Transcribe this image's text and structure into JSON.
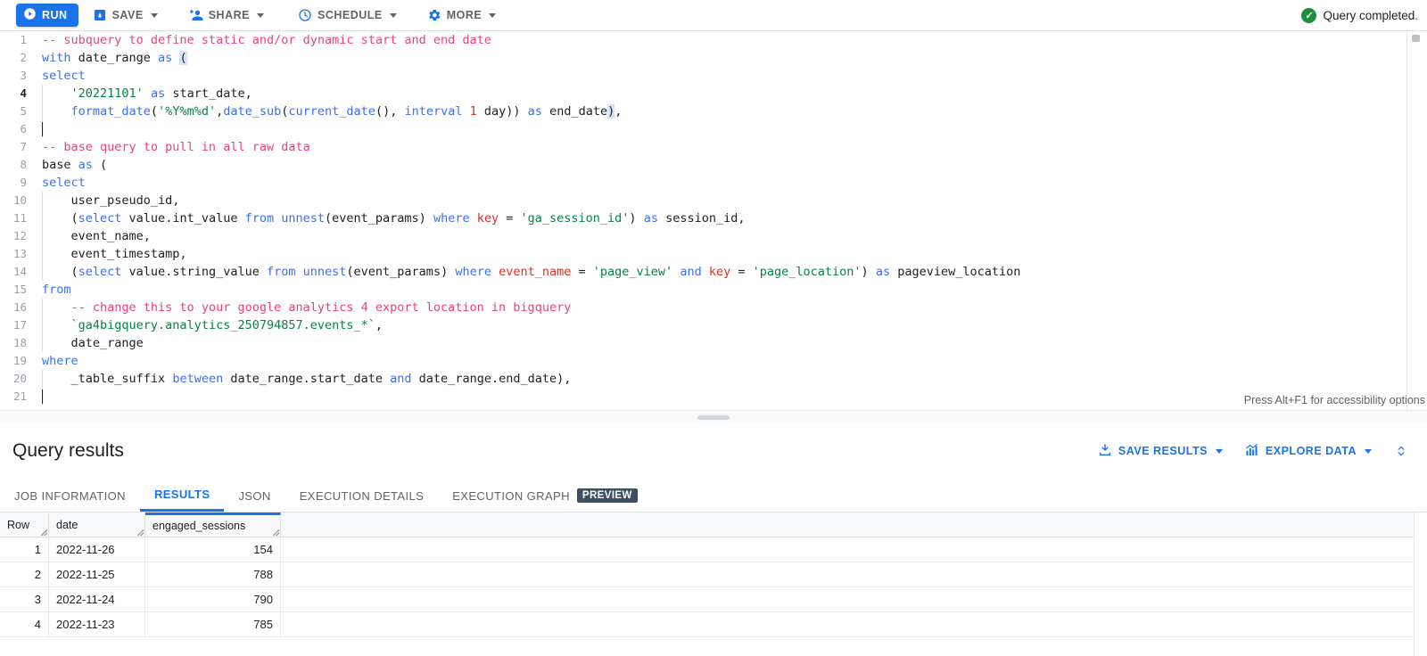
{
  "toolbar": {
    "run_label": "RUN",
    "items": [
      {
        "label": "SAVE",
        "icon": "save-icon"
      },
      {
        "label": "SHARE",
        "icon": "share-person-icon"
      },
      {
        "label": "SCHEDULE",
        "icon": "clock-icon"
      },
      {
        "label": "MORE",
        "icon": "gear-icon"
      }
    ],
    "status_text": "Query completed.",
    "status_color": "#1e8e3e"
  },
  "editor": {
    "accessibility_hint": "Press Alt+F1 for accessibility options",
    "current_line": 4,
    "lines": [
      {
        "n": "1",
        "indent": false,
        "tokens": [
          {
            "t": "-- subquery to define static and/or dynamic start and end date",
            "c": "c"
          }
        ]
      },
      {
        "n": "2",
        "indent": false,
        "tokens": [
          {
            "t": "with ",
            "c": "k"
          },
          {
            "t": "date_range ",
            "c": "p"
          },
          {
            "t": "as ",
            "c": "k"
          },
          {
            "t": "(",
            "c": "p bk"
          }
        ]
      },
      {
        "n": "3",
        "indent": false,
        "tokens": [
          {
            "t": "select",
            "c": "k"
          }
        ]
      },
      {
        "n": "4",
        "indent": true,
        "tokens": [
          {
            "t": "    ",
            "c": "p"
          },
          {
            "t": "'20221101'",
            "c": "s"
          },
          {
            "t": " ",
            "c": "p"
          },
          {
            "t": "as",
            "c": "k"
          },
          {
            "t": " start_date,",
            "c": "p"
          }
        ]
      },
      {
        "n": "5",
        "indent": true,
        "tokens": [
          {
            "t": "    ",
            "c": "p"
          },
          {
            "t": "format_date",
            "c": "k"
          },
          {
            "t": "(",
            "c": "p"
          },
          {
            "t": "'%Y%m%d'",
            "c": "s"
          },
          {
            "t": ",",
            "c": "p"
          },
          {
            "t": "date_sub",
            "c": "k"
          },
          {
            "t": "(",
            "c": "p"
          },
          {
            "t": "current_date",
            "c": "k"
          },
          {
            "t": "(), ",
            "c": "p"
          },
          {
            "t": "interval ",
            "c": "k"
          },
          {
            "t": "1",
            "c": "n"
          },
          {
            "t": " day)) ",
            "c": "p"
          },
          {
            "t": "as",
            "c": "k"
          },
          {
            "t": " end_date",
            "c": "p"
          },
          {
            "t": ")",
            "c": "p bk"
          },
          {
            "t": ",",
            "c": "p"
          }
        ]
      },
      {
        "n": "6",
        "indent": true,
        "tokens": []
      },
      {
        "n": "7",
        "indent": false,
        "tokens": [
          {
            "t": "-- base query to pull in all raw data",
            "c": "c"
          }
        ]
      },
      {
        "n": "8",
        "indent": false,
        "tokens": [
          {
            "t": "base ",
            "c": "p"
          },
          {
            "t": "as",
            "c": "k"
          },
          {
            "t": " (",
            "c": "p"
          }
        ]
      },
      {
        "n": "9",
        "indent": false,
        "tokens": [
          {
            "t": "select",
            "c": "k"
          }
        ]
      },
      {
        "n": "10",
        "indent": true,
        "tokens": [
          {
            "t": "    user_pseudo_id,",
            "c": "p"
          }
        ]
      },
      {
        "n": "11",
        "indent": true,
        "tokens": [
          {
            "t": "    (",
            "c": "p"
          },
          {
            "t": "select",
            "c": "k"
          },
          {
            "t": " value.int_value ",
            "c": "p"
          },
          {
            "t": "from ",
            "c": "k"
          },
          {
            "t": "unnest",
            "c": "k"
          },
          {
            "t": "(event_params) ",
            "c": "p"
          },
          {
            "t": "where ",
            "c": "k"
          },
          {
            "t": "key",
            "c": "n"
          },
          {
            "t": " = ",
            "c": "p"
          },
          {
            "t": "'ga_session_id'",
            "c": "s"
          },
          {
            "t": ") ",
            "c": "p"
          },
          {
            "t": "as",
            "c": "k"
          },
          {
            "t": " session_id,",
            "c": "p"
          }
        ]
      },
      {
        "n": "12",
        "indent": true,
        "tokens": [
          {
            "t": "    event_name,",
            "c": "p"
          }
        ]
      },
      {
        "n": "13",
        "indent": true,
        "tokens": [
          {
            "t": "    event_timestamp,",
            "c": "p"
          }
        ]
      },
      {
        "n": "14",
        "indent": true,
        "tokens": [
          {
            "t": "    (",
            "c": "p"
          },
          {
            "t": "select",
            "c": "k"
          },
          {
            "t": " value.string_value ",
            "c": "p"
          },
          {
            "t": "from ",
            "c": "k"
          },
          {
            "t": "unnest",
            "c": "k"
          },
          {
            "t": "(event_params) ",
            "c": "p"
          },
          {
            "t": "where ",
            "c": "k"
          },
          {
            "t": "event_name",
            "c": "n"
          },
          {
            "t": " = ",
            "c": "p"
          },
          {
            "t": "'page_view'",
            "c": "s"
          },
          {
            "t": " ",
            "c": "p"
          },
          {
            "t": "and ",
            "c": "k"
          },
          {
            "t": "key",
            "c": "n"
          },
          {
            "t": " = ",
            "c": "p"
          },
          {
            "t": "'page_location'",
            "c": "s"
          },
          {
            "t": ") ",
            "c": "p"
          },
          {
            "t": "as",
            "c": "k"
          },
          {
            "t": " pageview_location",
            "c": "p"
          }
        ]
      },
      {
        "n": "15",
        "indent": false,
        "tokens": [
          {
            "t": "from",
            "c": "k"
          }
        ]
      },
      {
        "n": "16",
        "indent": true,
        "tokens": [
          {
            "t": "    ",
            "c": "p"
          },
          {
            "t": "-- change this to your google analytics 4 export location in bigquery",
            "c": "c"
          }
        ]
      },
      {
        "n": "17",
        "indent": true,
        "tokens": [
          {
            "t": "    ",
            "c": "p"
          },
          {
            "t": "`ga4bigquery.analytics_250794857.events_*`",
            "c": "s"
          },
          {
            "t": ",",
            "c": "p"
          }
        ]
      },
      {
        "n": "18",
        "indent": true,
        "tokens": [
          {
            "t": "    date_range",
            "c": "p"
          }
        ]
      },
      {
        "n": "19",
        "indent": false,
        "tokens": [
          {
            "t": "where",
            "c": "k"
          }
        ]
      },
      {
        "n": "20",
        "indent": true,
        "tokens": [
          {
            "t": "    _table_suffix ",
            "c": "p"
          },
          {
            "t": "between",
            "c": "k"
          },
          {
            "t": " date_range.start_date ",
            "c": "p"
          },
          {
            "t": "and",
            "c": "k"
          },
          {
            "t": " date_range.end_date),",
            "c": "p"
          }
        ]
      },
      {
        "n": "21",
        "indent": true,
        "tokens": []
      }
    ]
  },
  "results": {
    "title": "Query results",
    "save_results_label": "SAVE RESULTS",
    "explore_data_label": "EXPLORE DATA",
    "tabs": [
      {
        "label": "JOB INFORMATION",
        "active": false,
        "badge": ""
      },
      {
        "label": "RESULTS",
        "active": true,
        "badge": ""
      },
      {
        "label": "JSON",
        "active": false,
        "badge": ""
      },
      {
        "label": "EXECUTION DETAILS",
        "active": false,
        "badge": ""
      },
      {
        "label": "EXECUTION GRAPH",
        "active": false,
        "badge": "PREVIEW"
      }
    ],
    "table": {
      "columns": [
        "Row",
        "date",
        "engaged_sessions"
      ],
      "selected_column": "engaged_sessions",
      "rows": [
        {
          "row": "1",
          "date": "2022-11-26",
          "engaged_sessions": "154"
        },
        {
          "row": "2",
          "date": "2022-11-25",
          "engaged_sessions": "788"
        },
        {
          "row": "3",
          "date": "2022-11-24",
          "engaged_sessions": "790"
        },
        {
          "row": "4",
          "date": "2022-11-23",
          "engaged_sessions": "785"
        }
      ]
    }
  }
}
